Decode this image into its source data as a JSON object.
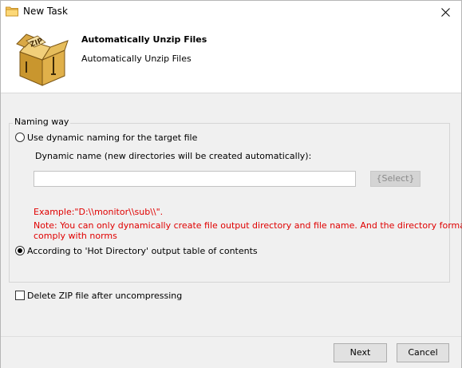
{
  "window": {
    "title": "New Task"
  },
  "header": {
    "title": "Automatically Unzip Files",
    "subtitle": "Automatically Unzip Files",
    "icon_text": "ZIP"
  },
  "naming": {
    "group_label": "Naming way",
    "dynamic_option": "Use dynamic naming for the target file",
    "dynamic_name_label": "Dynamic name (new directories will be created automatically):",
    "dynamic_name_value": "",
    "select_button": "{Select}",
    "example": "Example:\"D:\\\\monitor\\\\sub\\\\\".",
    "note_line1": "Note: You can only dynamically create file output directory and file name. And the directory format to",
    "note_line2": "comply with norms",
    "hot_directory_option": "According to 'Hot Directory' output table of contents",
    "selected": "hot_directory"
  },
  "delete_zip": {
    "label": "Delete ZIP file after uncompressing",
    "checked": false
  },
  "footer": {
    "next_label": "Next",
    "cancel_label": "Cancel"
  },
  "colors": {
    "note_red": "#e00000",
    "body_bg": "#f0f0f0"
  }
}
